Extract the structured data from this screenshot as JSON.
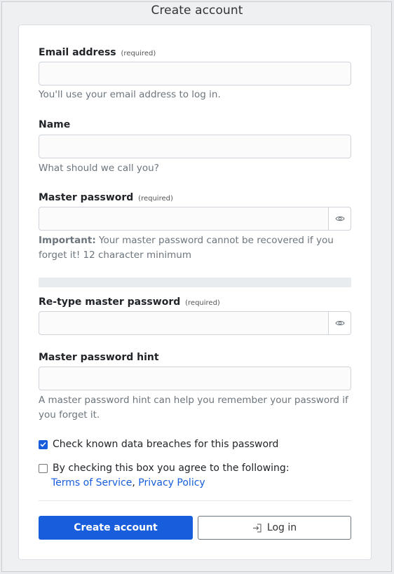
{
  "window": {
    "title": "Create account"
  },
  "form": {
    "email": {
      "label": "Email address",
      "required": "(required)",
      "value": "",
      "help": "You'll use your email address to log in."
    },
    "name": {
      "label": "Name",
      "value": "",
      "help": "What should we call you?"
    },
    "master_password": {
      "label": "Master password",
      "required": "(required)",
      "value": "",
      "help_strong": "Important:",
      "help": " Your master password cannot be recovered if you forget it! 12 character minimum"
    },
    "retype_password": {
      "label": "Re-type master password",
      "required": "(required)",
      "value": ""
    },
    "hint": {
      "label": "Master password hint",
      "value": "",
      "help": "A master password hint can help you remember your password if you forget it."
    },
    "breach_check": {
      "label": "Check known data breaches for this password",
      "checked": true
    },
    "terms": {
      "label": "By checking this box you agree to the following:",
      "checked": false,
      "tos_link": "Terms of Service",
      "separator": ",",
      "privacy_link": "Privacy Policy"
    },
    "password_strength": 0
  },
  "actions": {
    "create_label": "Create account",
    "login_label": "Log in"
  },
  "colors": {
    "primary": "#175ddc",
    "link": "#175ddc",
    "muted": "#6c757d"
  },
  "icons": {
    "password_toggle": "eye-icon",
    "login": "sign-in-icon",
    "checked": "checkmark-icon"
  }
}
